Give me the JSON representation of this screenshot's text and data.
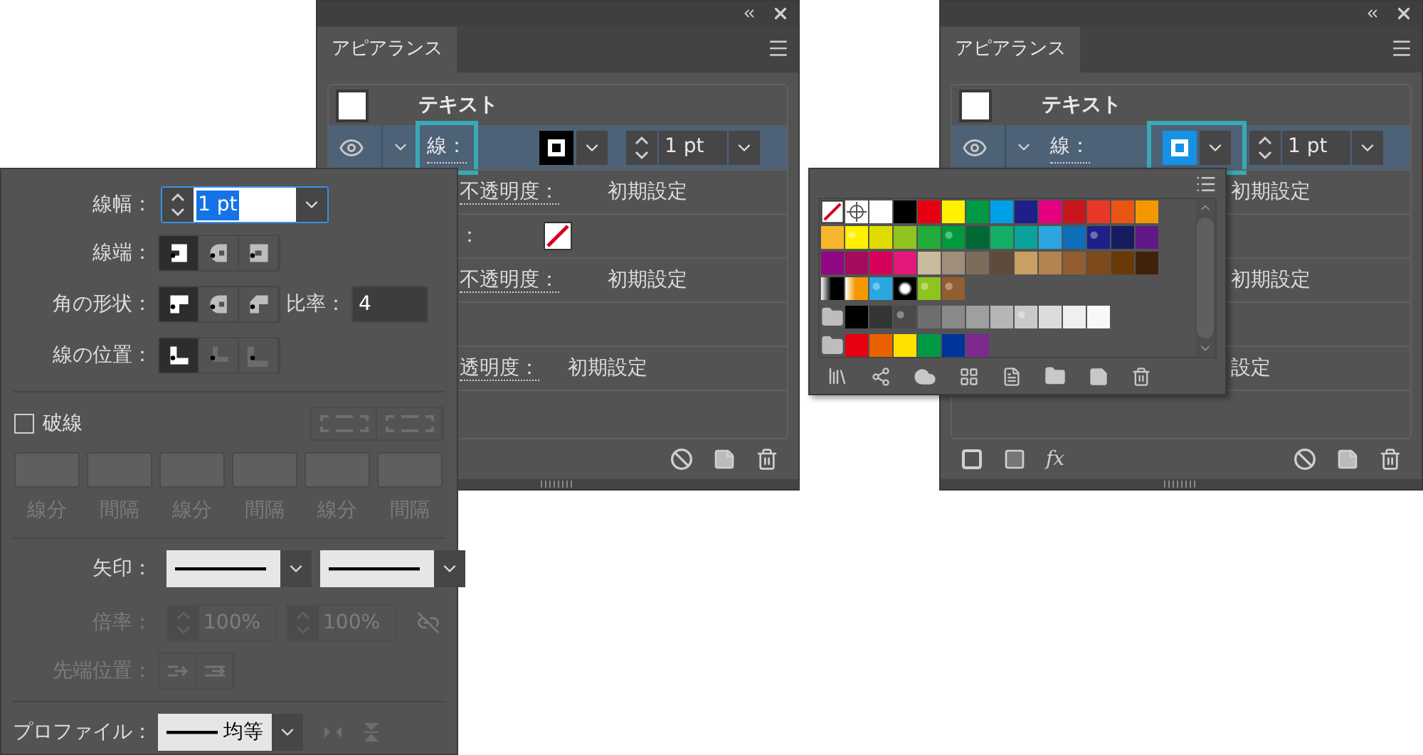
{
  "appearance_panels": [
    {
      "tab": {
        "label": "アピアランス",
        "selected": true
      },
      "object_label": "テキスト",
      "stroke_row": {
        "label": "線：",
        "weight": "1 pt",
        "selected": true,
        "swatch_selected": false,
        "label_highlighted": true,
        "swatch_highlighted": false
      },
      "rows": [
        {
          "kind": "sub",
          "label": "不透明度：",
          "value": "初期設定"
        },
        {
          "kind": "swatch",
          "label": "："
        },
        {
          "kind": "sub",
          "label": "不透明度：",
          "value": "初期設定"
        },
        {
          "kind": "empty"
        },
        {
          "kind": "top",
          "label": "透明度：",
          "value": "初期設定"
        },
        {
          "kind": "empty"
        }
      ]
    },
    {
      "tab": {
        "label": "アピアランス",
        "selected": true
      },
      "object_label": "テキスト",
      "stroke_row": {
        "label": "線：",
        "weight": "1 pt",
        "selected": true,
        "swatch_selected": true,
        "label_highlighted": false,
        "swatch_highlighted": true
      },
      "footer_tools": {
        "fx_label": "fx"
      },
      "rows": [
        {
          "kind": "sub",
          "value": "初期設定"
        },
        {
          "kind": "empty"
        },
        {
          "kind": "sub",
          "value": "初期設定"
        },
        {
          "kind": "empty"
        },
        {
          "kind": "sub",
          "value": "設定"
        },
        {
          "kind": "empty"
        }
      ]
    }
  ],
  "stroke_panel": {
    "weight": {
      "label": "線幅：",
      "value": "1 pt"
    },
    "cap": {
      "label": "線端：",
      "options": [
        {
          "kind": "butt",
          "selected": true,
          "disabled": false
        },
        {
          "kind": "round",
          "selected": false,
          "disabled": false
        },
        {
          "kind": "projecting",
          "selected": false,
          "disabled": false
        }
      ]
    },
    "corner": {
      "label": "角の形状：",
      "options": [
        {
          "kind": "miter",
          "selected": true,
          "disabled": false
        },
        {
          "kind": "round",
          "selected": false,
          "disabled": false
        },
        {
          "kind": "bevel",
          "selected": false,
          "disabled": false
        }
      ],
      "limit_label": "比率：",
      "limit_value": "4"
    },
    "align": {
      "label": "線の位置：",
      "options": [
        {
          "kind": "center",
          "selected": true,
          "disabled": false
        },
        {
          "kind": "inside",
          "selected": false,
          "disabled": true
        },
        {
          "kind": "outside",
          "selected": false,
          "disabled": true
        }
      ]
    },
    "dash": {
      "label": "破線",
      "checked": false,
      "disabled": true,
      "fields": [
        "線分",
        "間隔",
        "線分",
        "間隔",
        "線分",
        "間隔"
      ]
    },
    "arrows": {
      "label": "矢印："
    },
    "scale": {
      "label": "倍率：",
      "values": [
        "100%",
        "100%"
      ],
      "disabled": true
    },
    "tip": {
      "label": "先端位置：",
      "disabled": true
    },
    "profile": {
      "label": "プロファイル：",
      "value": "均等"
    }
  },
  "swatch_popup": {
    "rows": [
      {
        "folder": false,
        "swatches": [
          {
            "kind": "none"
          },
          {
            "kind": "registration"
          },
          {
            "kind": "color",
            "color": "#ffffff"
          },
          {
            "kind": "color",
            "color": "#000000"
          },
          {
            "kind": "color",
            "color": "#e60012"
          },
          {
            "kind": "color",
            "color": "#fff100"
          },
          {
            "kind": "color",
            "color": "#009944"
          },
          {
            "kind": "color",
            "color": "#00a0e9"
          },
          {
            "kind": "color",
            "color": "#1d2088"
          },
          {
            "kind": "color",
            "color": "#e4007f"
          },
          {
            "kind": "color",
            "color": "#c9161d"
          },
          {
            "kind": "color",
            "color": "#e83828"
          },
          {
            "kind": "color",
            "color": "#ea5514"
          },
          {
            "kind": "color",
            "color": "#f39800"
          }
        ]
      },
      {
        "folder": false,
        "swatches": [
          {
            "kind": "color",
            "color": "#f8b62d"
          },
          {
            "kind": "pattern",
            "color": "#fff100"
          },
          {
            "kind": "color",
            "color": "#dfdd00"
          },
          {
            "kind": "color",
            "color": "#8fc31f"
          },
          {
            "kind": "color",
            "color": "#22ac38"
          },
          {
            "kind": "pattern",
            "color": "#009a3e"
          },
          {
            "kind": "color",
            "color": "#006934"
          },
          {
            "kind": "color",
            "color": "#13ae67"
          },
          {
            "kind": "color",
            "color": "#0aa29b"
          },
          {
            "kind": "color",
            "color": "#2ca6e0"
          },
          {
            "kind": "color",
            "color": "#0f6eb8"
          },
          {
            "kind": "pattern",
            "color": "#1d2088"
          },
          {
            "kind": "color",
            "color": "#171c61"
          },
          {
            "kind": "color",
            "color": "#601986"
          }
        ]
      },
      {
        "folder": false,
        "swatches": [
          {
            "kind": "color",
            "color": "#920783"
          },
          {
            "kind": "color",
            "color": "#a40b5d"
          },
          {
            "kind": "color",
            "color": "#d7005b"
          },
          {
            "kind": "color",
            "color": "#e4187a"
          },
          {
            "kind": "color",
            "color": "#c9bc9c"
          },
          {
            "kind": "color",
            "color": "#a08d7a"
          },
          {
            "kind": "color",
            "color": "#7d6c5b"
          },
          {
            "kind": "color",
            "color": "#5f4b3d"
          },
          {
            "kind": "color",
            "color": "#c9a063"
          },
          {
            "kind": "color",
            "color": "#b38450"
          },
          {
            "kind": "color",
            "color": "#925d31"
          },
          {
            "kind": "color",
            "color": "#7d4a1e"
          },
          {
            "kind": "color",
            "color": "#6a3906"
          },
          {
            "kind": "color",
            "color": "#42210b"
          }
        ]
      },
      {
        "folder": false,
        "swatches": [
          {
            "kind": "gradient",
            "color": "#000000"
          },
          {
            "kind": "gradient",
            "color": "#f39800"
          },
          {
            "kind": "pattern",
            "color": "#2ca6e0"
          },
          {
            "kind": "radial",
            "color": "#000000"
          },
          {
            "kind": "pattern",
            "color": "#8fc31f"
          },
          {
            "kind": "pattern",
            "color": "#925d31"
          }
        ]
      },
      {
        "folder": true,
        "swatches": [
          {
            "kind": "color",
            "color": "#000000"
          },
          {
            "kind": "color",
            "color": "#353535"
          },
          {
            "kind": "pattern",
            "color": "#4a4a4a"
          },
          {
            "kind": "color",
            "color": "#6e6e6e"
          },
          {
            "kind": "color",
            "color": "#898989"
          },
          {
            "kind": "color",
            "color": "#9f9f9f"
          },
          {
            "kind": "color",
            "color": "#b5b5b5"
          },
          {
            "kind": "pattern",
            "color": "#c9c9c9"
          },
          {
            "kind": "color",
            "color": "#dcdcdd"
          },
          {
            "kind": "color",
            "color": "#efefef"
          },
          {
            "kind": "color",
            "color": "#f7f8f8"
          }
        ]
      },
      {
        "folder": true,
        "swatches": [
          {
            "kind": "color",
            "color": "#e60012"
          },
          {
            "kind": "color",
            "color": "#eb6100"
          },
          {
            "kind": "color",
            "color": "#ffe100"
          },
          {
            "kind": "color",
            "color": "#009944"
          },
          {
            "kind": "color",
            "color": "#00349a"
          },
          {
            "kind": "color",
            "color": "#7c2a8f"
          }
        ]
      }
    ]
  }
}
